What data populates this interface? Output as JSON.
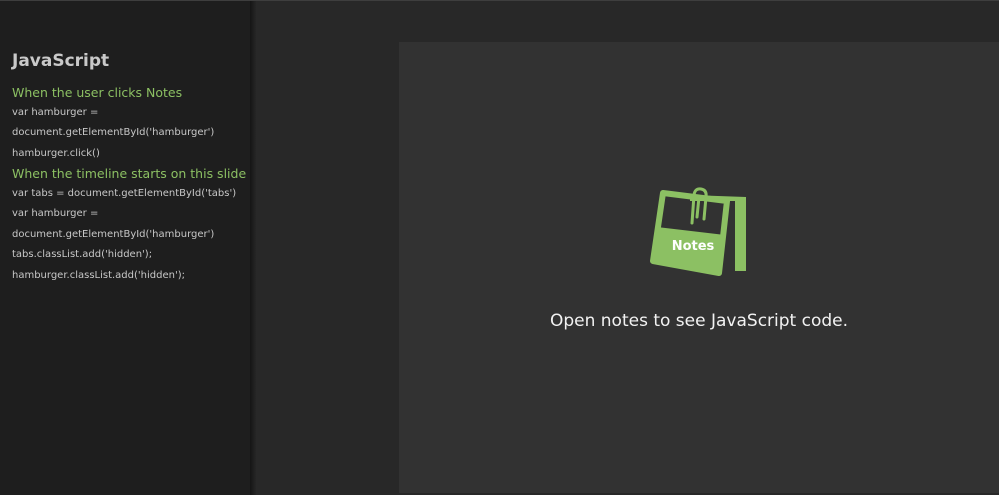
{
  "sidebar": {
    "title": "JavaScript",
    "sections": [
      {
        "heading": "When the user clicks Notes",
        "lines": [
          "var hamburger =",
          "document.getElementById('hamburger')",
          "hamburger.click()"
        ]
      },
      {
        "heading": "When the timeline starts on this slide",
        "lines": [
          "var tabs = document.getElementById('tabs')",
          "var hamburger =",
          "document.getElementById('hamburger')",
          "tabs.classList.add('hidden');",
          "hamburger.classList.add('hidden');"
        ]
      }
    ]
  },
  "slide": {
    "icon_name": "notes-icon",
    "icon_label": "Notes",
    "message": "Open notes to see JavaScript code.",
    "accent_color": "#8cc063"
  }
}
